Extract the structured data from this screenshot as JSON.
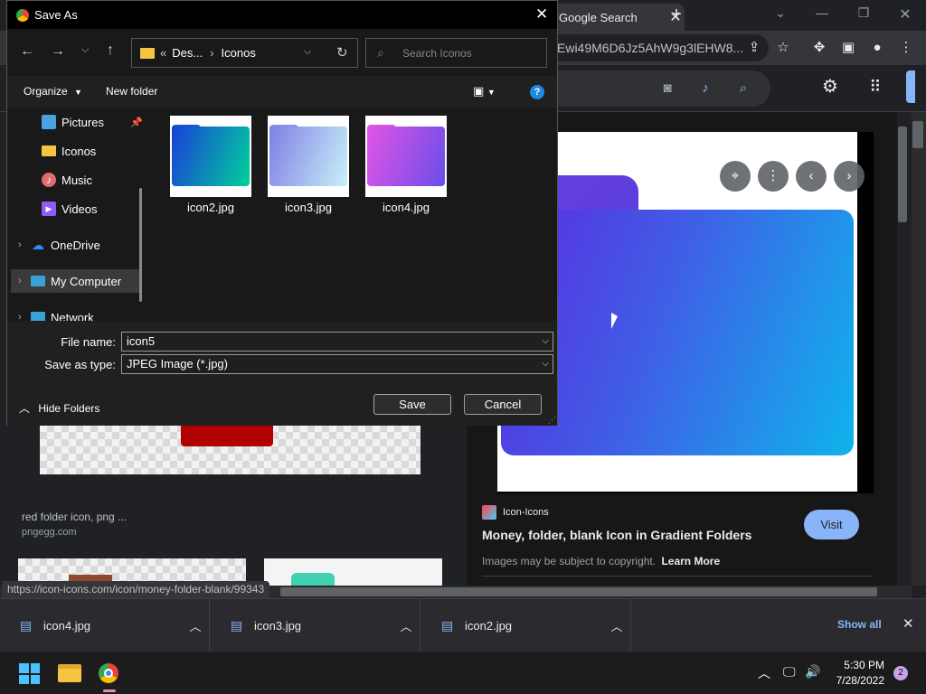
{
  "browser": {
    "tab_title": "Google Search",
    "tab_close": "✕",
    "new_tab": "+",
    "url_fragment": "Ewi49M6D6Jz5AhW9g3lEHW8...",
    "status_url": "https://icon-icons.com/icon/money-folder-blank/99343"
  },
  "results": {
    "red_caption": "red folder icon, png ...",
    "red_source": "pngegg.com"
  },
  "preview": {
    "site_name": "Icon-Icons",
    "title": "Money, folder, blank Icon in Gradient Folders",
    "copyright": "Images may be subject to copyright.",
    "learn_more": "Learn More",
    "visit": "Visit"
  },
  "downloads": {
    "items": [
      {
        "name": "icon4.jpg"
      },
      {
        "name": "icon3.jpg"
      },
      {
        "name": "icon2.jpg"
      }
    ],
    "show_all": "Show all"
  },
  "taskbar": {
    "time": "5:30 PM",
    "date": "7/28/2022",
    "badge": "2"
  },
  "dialog": {
    "title": "Save As",
    "breadcrumb_prefix": "«",
    "breadcrumb_1": "Des...",
    "breadcrumb_sep": "›",
    "breadcrumb_2": "Iconos",
    "search_placeholder": "Search Iconos",
    "organize": "Organize",
    "new_folder": "New folder",
    "nav": [
      {
        "label": "Pictures"
      },
      {
        "label": "Iconos"
      },
      {
        "label": "Music"
      },
      {
        "label": "Videos"
      },
      {
        "label": "OneDrive"
      },
      {
        "label": "My Computer"
      },
      {
        "label": "Network"
      }
    ],
    "files": [
      {
        "name": "icon2.jpg"
      },
      {
        "name": "icon3.jpg"
      },
      {
        "name": "icon4.jpg"
      }
    ],
    "file_name_label": "File name:",
    "file_name_value": "icon5",
    "save_type_label": "Save as type:",
    "save_type_value": "JPEG Image (*.jpg)",
    "hide_folders": "Hide Folders",
    "save": "Save",
    "cancel": "Cancel"
  },
  "colors": {
    "accent": "#8ab4f8",
    "visit_button": "#8ab4f8",
    "selection": "#3a3a3a"
  }
}
